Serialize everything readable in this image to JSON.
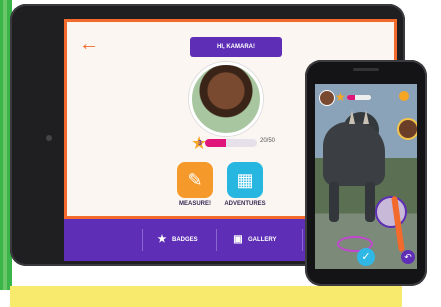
{
  "tablet": {
    "greeting": "HI, KAMARA!",
    "xp": {
      "level": "3",
      "progress_text": "20/50",
      "progress": 0.4
    },
    "tiles": [
      {
        "label": "MEASURE!",
        "icon": "ruler-pencil-icon"
      },
      {
        "label": "ADVENTURES",
        "icon": "map-icon"
      }
    ],
    "bottom_nav": [
      {
        "label": "BADGES",
        "icon": "badge-icon"
      },
      {
        "label": "GALLERY",
        "icon": "gallery-icon"
      }
    ]
  },
  "phone": {
    "xp_progress": 0.35
  },
  "colors": {
    "accent_orange": "#f26a2c",
    "brand_purple": "#5e2fb6",
    "measure_tile": "#f59a2a",
    "adventures_tile": "#27b6e0",
    "xp_fill": "#e0157a"
  }
}
